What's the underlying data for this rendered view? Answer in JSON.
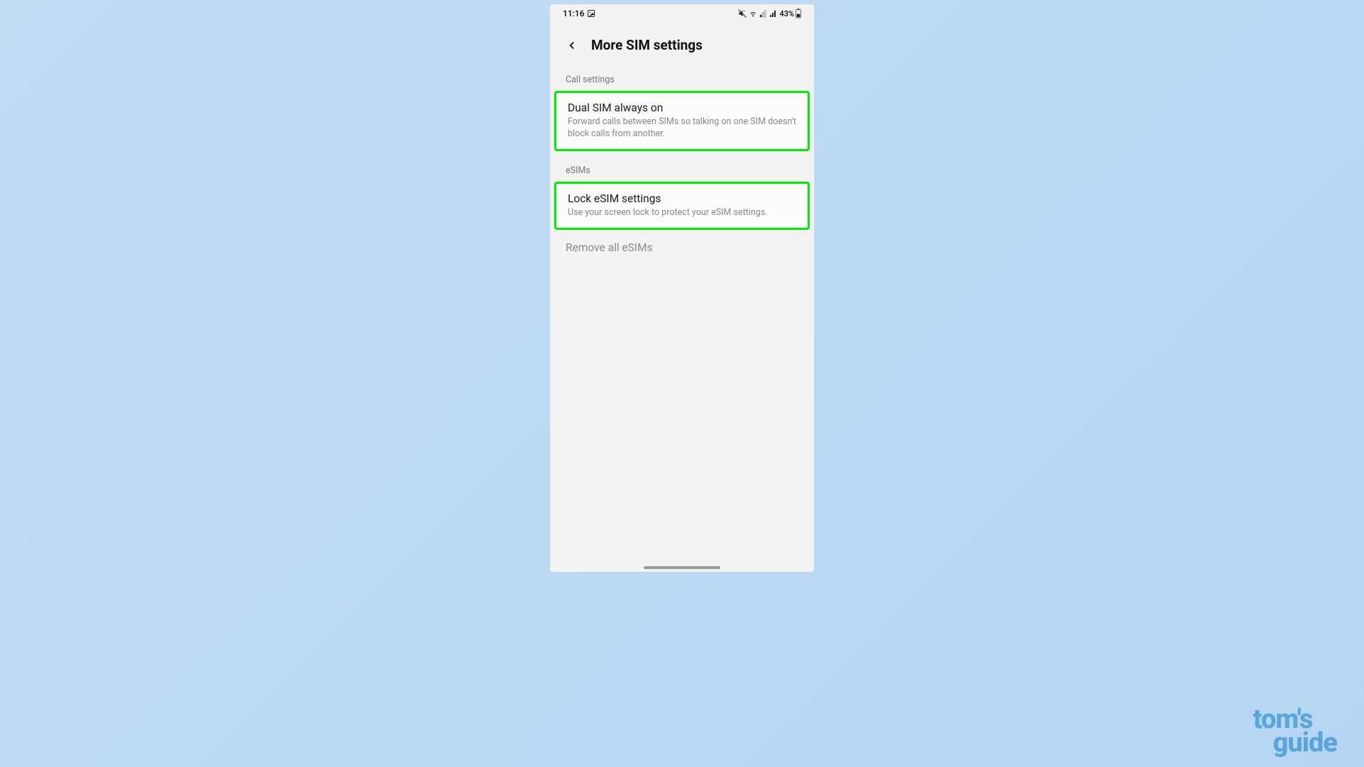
{
  "status": {
    "time": "11:16",
    "battery_pct": "43%"
  },
  "header": {
    "title": "More SIM settings"
  },
  "sections": {
    "call_settings": {
      "label": "Call settings",
      "dual_sim": {
        "title": "Dual SIM always on",
        "desc": "Forward calls between SIMs so talking on one SIM doesn't block calls from another."
      }
    },
    "esims": {
      "label": "eSIMs",
      "lock": {
        "title": "Lock eSIM settings",
        "desc": "Use your screen lock to protect your eSIM settings."
      },
      "remove_all": {
        "title": "Remove all eSIMs"
      }
    }
  },
  "branding": {
    "line1": "tom's",
    "line2": "guide"
  }
}
